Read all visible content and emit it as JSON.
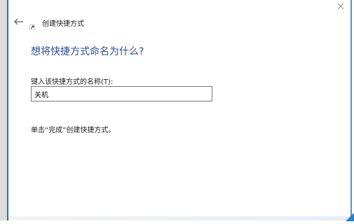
{
  "window": {
    "title": "创建快捷方式",
    "back_icon": "back-arrow-icon",
    "close_icon": "close-icon",
    "app_icon": "shortcut-icon"
  },
  "main": {
    "heading": "想将快捷方式命名为什么?",
    "name_label": "键入该快捷方式的名称(T):",
    "name_value": "关机",
    "finish_hint": "单击“完成”创建快捷方式。"
  },
  "colors": {
    "heading": "#2f4e9a",
    "accent": "#1a73c8"
  }
}
